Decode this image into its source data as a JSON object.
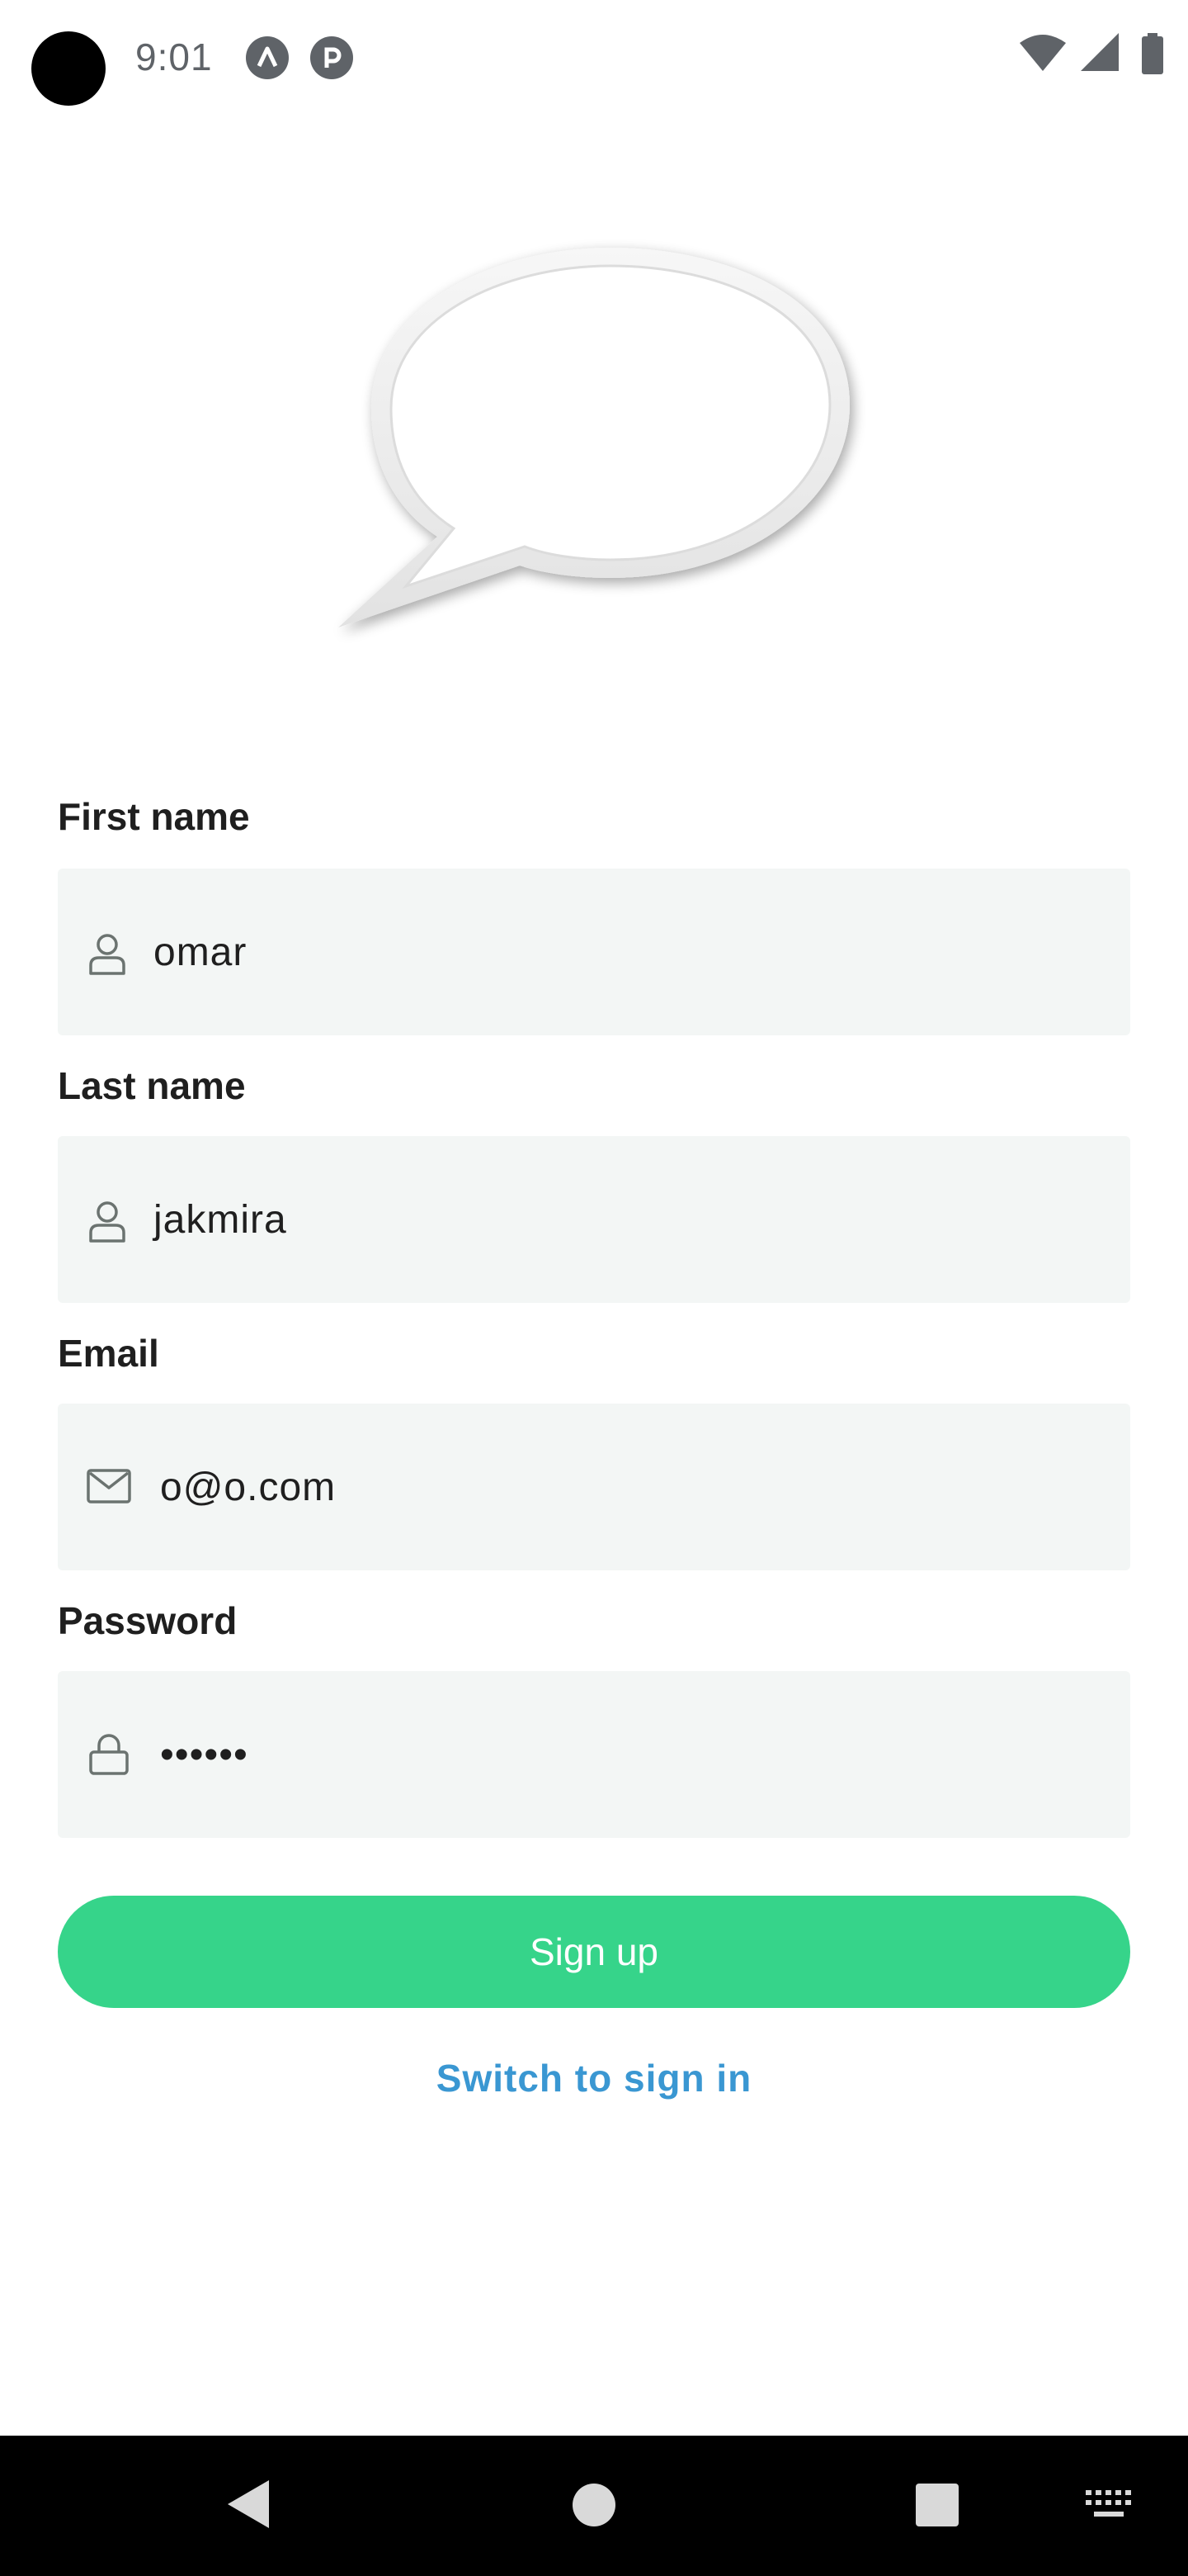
{
  "status_bar": {
    "time": "9:01",
    "icons": [
      "notification-a-icon",
      "notification-p-icon",
      "wifi-icon",
      "cellular-signal-icon",
      "battery-icon"
    ]
  },
  "form": {
    "first_name": {
      "label": "First name",
      "value": "omar",
      "icon": "user-icon"
    },
    "last_name": {
      "label": "Last name",
      "value": "jakmira",
      "icon": "user-icon"
    },
    "email": {
      "label": "Email",
      "value": "o@o.com",
      "icon": "mail-icon"
    },
    "password": {
      "label": "Password",
      "value": "••••••",
      "icon": "lock-icon"
    }
  },
  "actions": {
    "signup_label": "Sign up",
    "switch_label": "Switch to sign in"
  },
  "colors": {
    "accent": "#36d48a",
    "link": "#3a97d2",
    "field_bg": "#f3f6f5"
  },
  "nav_bar": {
    "icons": [
      "back-icon",
      "home-icon",
      "recents-icon",
      "keyboard-icon"
    ]
  }
}
